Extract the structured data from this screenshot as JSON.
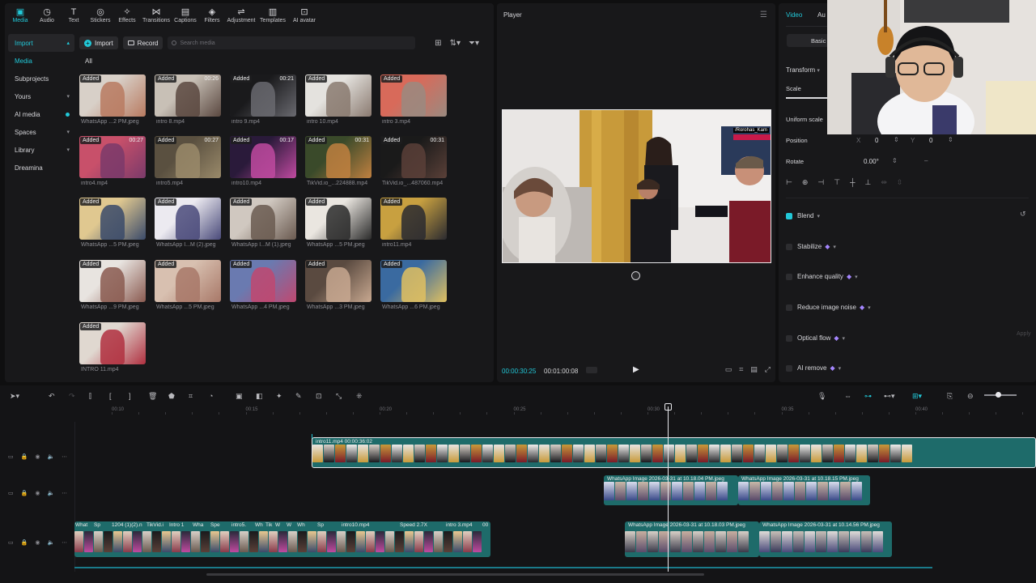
{
  "toolbar": {
    "tools": [
      {
        "label": "Media",
        "icon": "media-icon",
        "active": true
      },
      {
        "label": "Audio",
        "icon": "audio-icon"
      },
      {
        "label": "Text",
        "icon": "text-icon"
      },
      {
        "label": "Stickers",
        "icon": "stickers-icon"
      },
      {
        "label": "Effects",
        "icon": "effects-icon"
      },
      {
        "label": "Transitions",
        "icon": "transitions-icon"
      },
      {
        "label": "Captions",
        "icon": "captions-icon"
      },
      {
        "label": "Filters",
        "icon": "filters-icon"
      },
      {
        "label": "Adjustment",
        "icon": "adjustment-icon"
      },
      {
        "label": "Templates",
        "icon": "templates-icon"
      },
      {
        "label": "AI avatar",
        "icon": "ai-avatar-icon"
      }
    ]
  },
  "sidebar": {
    "items": [
      {
        "label": "Import",
        "style": "head"
      },
      {
        "label": "Media",
        "style": "sel"
      },
      {
        "label": "Subprojects",
        "style": ""
      },
      {
        "label": "Yours",
        "style": "",
        "chevron": true
      },
      {
        "label": "AI media",
        "style": "",
        "chevron": true,
        "dot": true
      },
      {
        "label": "Spaces",
        "style": "",
        "chevron": true
      },
      {
        "label": "Library",
        "style": "",
        "chevron": true
      },
      {
        "label": "Dreamina",
        "style": ""
      }
    ]
  },
  "media": {
    "import_label": "Import",
    "record_label": "Record",
    "search_placeholder": "Search media",
    "filter_label": "All",
    "items": [
      {
        "caption": "WhatsApp ...2 PM.jpeg",
        "tag": "Added",
        "duration": "",
        "c1": "#d8d0c8",
        "c2": "#b87a60"
      },
      {
        "caption": "intro 8.mp4",
        "tag": "Added",
        "duration": "00:26",
        "c1": "#c8c0b6",
        "c2": "#5a4840"
      },
      {
        "caption": "intro 9.mp4",
        "tag": "Added",
        "duration": "00:21",
        "c1": "#1a1a1c",
        "c2": "#6a6a70"
      },
      {
        "caption": "intro 10.mp4",
        "tag": "Added",
        "duration": "",
        "c1": "#e4e2de",
        "c2": "#8a7a70"
      },
      {
        "caption": "intro 3.mp4",
        "tag": "Added",
        "duration": "",
        "c1": "#d86a5a",
        "c2": "#9a8a80"
      },
      {
        "caption": "intro4.mp4",
        "tag": "Added",
        "duration": "00:27",
        "c1": "#c8506a",
        "c2": "#7a3a6a"
      },
      {
        "caption": "intro5.mp4",
        "tag": "Added",
        "duration": "00:27",
        "c1": "#5a5040",
        "c2": "#9a8a6a"
      },
      {
        "caption": "intro10.mp4",
        "tag": "Added",
        "duration": "00:17",
        "c1": "#2a1a3a",
        "c2": "#c04aa0"
      },
      {
        "caption": "TikVid.io_...224888.mp4",
        "tag": "Added",
        "duration": "00:31",
        "c1": "#3a4a2a",
        "c2": "#c08040"
      },
      {
        "caption": "TikVid.io_...487060.mp4",
        "tag": "Added",
        "duration": "00:31",
        "c1": "#1a1a1a",
        "c2": "#5a4038"
      },
      {
        "caption": "WhatsApp ...5 PM.jpeg",
        "tag": "Added",
        "duration": "",
        "c1": "#e0c890",
        "c2": "#3a4a6a"
      },
      {
        "caption": "WhatsApp I...M (2).jpeg",
        "tag": "Added",
        "duration": "",
        "c1": "#eceaf0",
        "c2": "#4a4a7a"
      },
      {
        "caption": "WhatsApp I...M (1).jpeg",
        "tag": "Added",
        "duration": "",
        "c1": "#d0c8c0",
        "c2": "#6a5a50"
      },
      {
        "caption": "WhatsApp ...5 PM.jpeg",
        "tag": "Added",
        "duration": "",
        "c1": "#eae6e0",
        "c2": "#2a2a2a"
      },
      {
        "caption": "intro11.mp4",
        "tag": "Added",
        "duration": "",
        "c1": "#c8a040",
        "c2": "#2a2a30"
      },
      {
        "caption": "WhatsApp ...9 PM.jpeg",
        "tag": "Added",
        "duration": "",
        "c1": "#e8e4e0",
        "c2": "#8a5a50"
      },
      {
        "caption": "WhatsApp ...5 PM.jpeg",
        "tag": "Added",
        "duration": "",
        "c1": "#d8c0b0",
        "c2": "#a87868"
      },
      {
        "caption": "WhatsApp ...4 PM.jpeg",
        "tag": "Added",
        "duration": "",
        "c1": "#6a7ab0",
        "c2": "#c04870"
      },
      {
        "caption": "WhatsApp ...3 PM.jpeg",
        "tag": "Added",
        "duration": "",
        "c1": "#5a4a40",
        "c2": "#c8a890"
      },
      {
        "caption": "WhatsApp ...6 PM.jpeg",
        "tag": "Added",
        "duration": "",
        "c1": "#3a6aa0",
        "c2": "#e0c060"
      },
      {
        "caption": "INTRO 11.mp4",
        "tag": "Added",
        "duration": "",
        "c1": "#e0d8d0",
        "c2": "#b03040"
      }
    ]
  },
  "player": {
    "title": "Player",
    "current_time": "00:00:30:25",
    "total_time": "00:01:00:08",
    "watermark": "/Rorohas_Kam"
  },
  "inspector": {
    "tabs": [
      "Video",
      "Au"
    ],
    "subtab": "Basic",
    "transform_label": "Transform",
    "scale_label": "Scale",
    "uniform_scale_label": "Uniform scale",
    "position_label": "Position",
    "pos_x_label": "X",
    "pos_x": "0",
    "pos_y_label": "Y",
    "pos_y": "0",
    "rotate_label": "Rotate",
    "rotate_value": "0.00°",
    "features": [
      {
        "label": "Blend",
        "on": true,
        "premium": false
      },
      {
        "label": "Stabilize",
        "on": false,
        "premium": true
      },
      {
        "label": "Enhance quality",
        "on": false,
        "premium": true
      },
      {
        "label": "Reduce image noise",
        "on": false,
        "premium": true
      },
      {
        "label": "Optical flow",
        "on": false,
        "premium": true
      },
      {
        "label": "AI remove",
        "on": false,
        "premium": true
      }
    ],
    "apply_label": "Apply"
  },
  "timeline": {
    "ruler": [
      "00:10",
      "00:15",
      "00:20",
      "00:25",
      "00:30",
      "00:35",
      "00:40"
    ],
    "clips": {
      "main": {
        "label": "intro11.mp4  00:00:36:02"
      },
      "overlay_a": {
        "label": "WhatsApp Image 2026-03-31 at 10.18.04 PM.jpeg"
      },
      "overlay_b": {
        "label": "WhatsApp Image 2026-03-31 at 10.18.15 PM.jpeg"
      },
      "lower_a": {
        "label": "WhatsApp Image 2026-03-31 at 10.18.03 PM.jpeg"
      },
      "lower_b": {
        "label": "WhatsApp Image 2026-03-31 at 10.14.56 PM.jpeg"
      },
      "lower_mix": {
        "labels": [
          "What",
          "Sp",
          "1204 (1)(2).n",
          "TikVid.i",
          "Intro 1",
          "Wha",
          "Spe",
          "intro5.",
          "Wh",
          "Tik",
          "W",
          "W",
          "Wh",
          "Sp",
          "intro10.mp4",
          "Speed 2.7X",
          "intro 3.mp4",
          "00"
        ]
      }
    },
    "colors": {
      "track": "#1e6b6a",
      "track_dark": "#14504f",
      "accent": "#22c8d8"
    }
  }
}
